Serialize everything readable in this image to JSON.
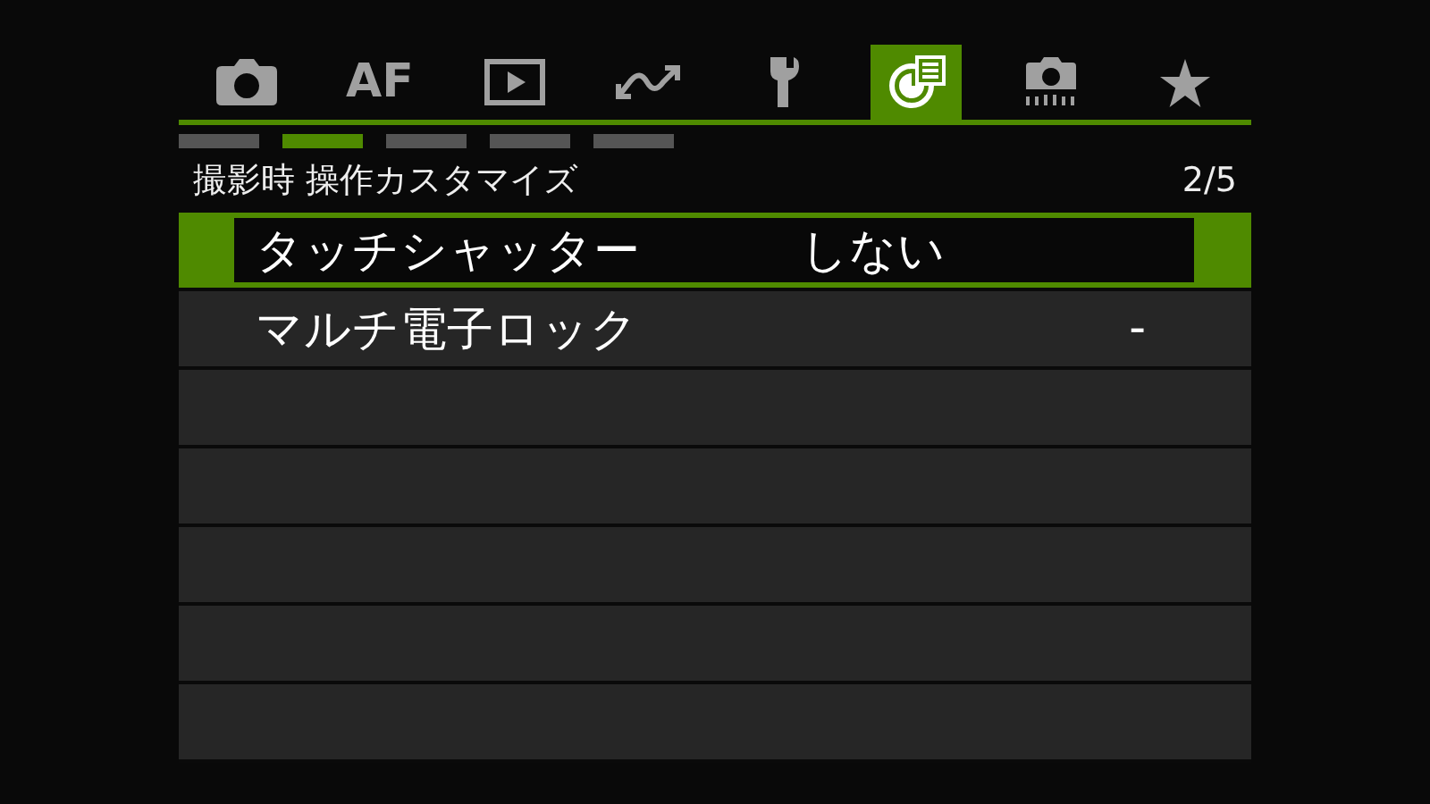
{
  "tabs": [
    {
      "kind": "camera",
      "selected": false
    },
    {
      "kind": "text",
      "label": "AF",
      "selected": false
    },
    {
      "kind": "play",
      "selected": false
    },
    {
      "kind": "wave",
      "selected": false
    },
    {
      "kind": "wrench",
      "selected": false
    },
    {
      "kind": "custom",
      "selected": true
    },
    {
      "kind": "camera-dots",
      "selected": false
    },
    {
      "kind": "star",
      "selected": false
    }
  ],
  "pages": [
    {
      "selected": false
    },
    {
      "selected": true
    },
    {
      "selected": false
    },
    {
      "selected": false
    },
    {
      "selected": false
    }
  ],
  "header": {
    "title": "撮影時 操作カスタマイズ",
    "page": "2/5"
  },
  "rows": [
    {
      "label": "タッチシャッター",
      "value": "しない",
      "selected": true
    },
    {
      "label": "マルチ電子ロック",
      "value": "-",
      "selected": false
    }
  ]
}
